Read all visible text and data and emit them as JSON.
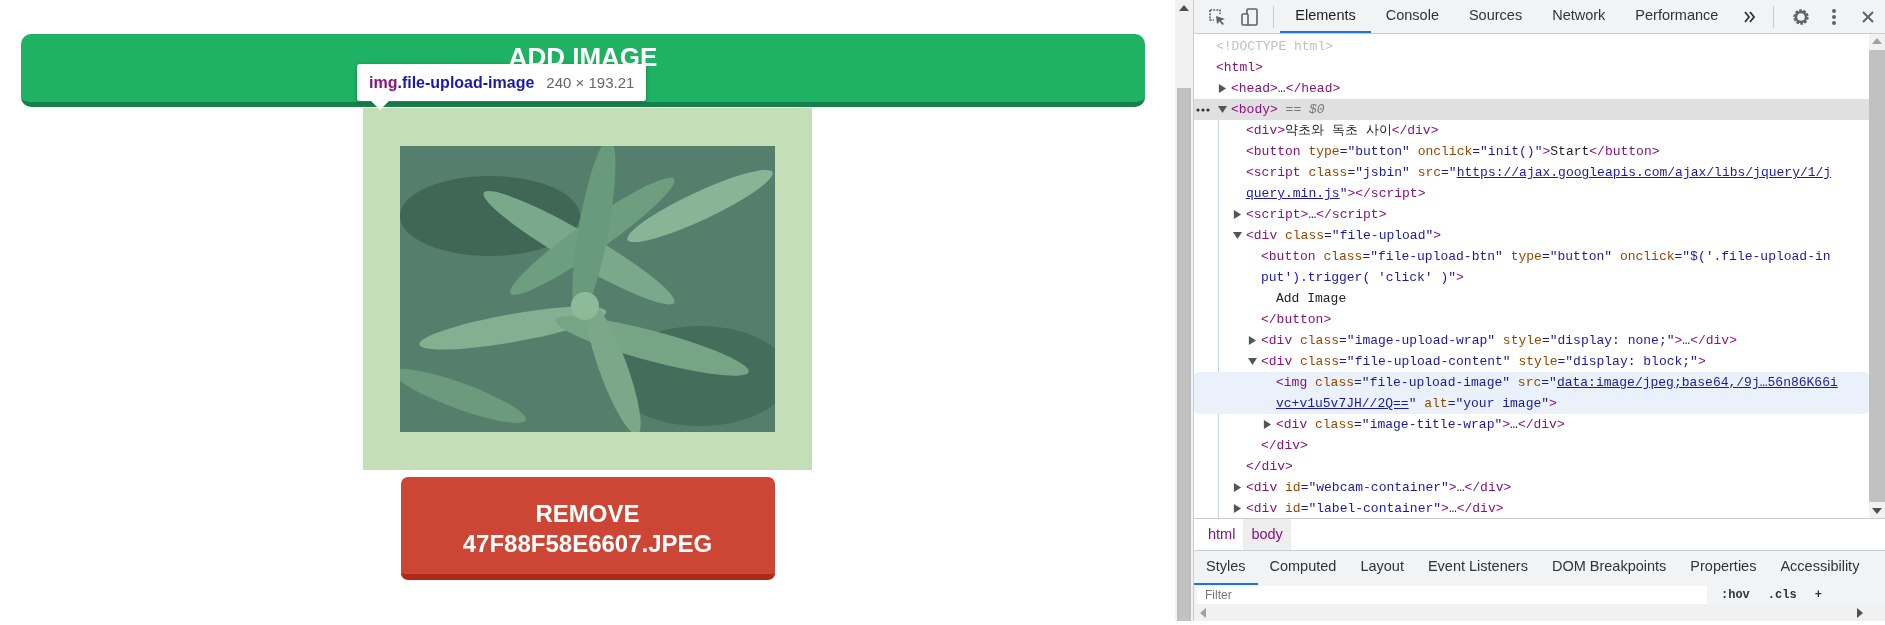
{
  "page": {
    "add_button": "ADD IMAGE",
    "tooltip": {
      "tag": "img",
      "class_name": ".file-upload-image",
      "size": "240 × 193.21"
    },
    "remove_button": "REMOVE 47F88F58E6607.JPEG"
  },
  "devtools": {
    "tabs": [
      {
        "label": "Elements",
        "selected": true
      },
      {
        "label": "Console",
        "selected": false
      },
      {
        "label": "Sources",
        "selected": false
      },
      {
        "label": "Network",
        "selected": false
      },
      {
        "label": "Performance",
        "selected": false
      }
    ],
    "dom": [
      {
        "kind": "plain",
        "selected": false,
        "hovered": false,
        "lines": [
          [
            {
              "kind": "doctype",
              "text": "<!DOCTYPE html>"
            }
          ]
        ]
      },
      {
        "kind": "plain",
        "selected": false,
        "hovered": false,
        "lines": [
          [
            {
              "kind": "tag",
              "text": "<html>"
            }
          ]
        ],
        "children": [
          {
            "kind": "branch",
            "expanded": false,
            "selected": false,
            "hovered": false,
            "lines": [
              [
                {
                  "kind": "tag",
                  "text": "<head>"
                },
                {
                  "kind": "text",
                  "text": "…"
                },
                {
                  "kind": "tag",
                  "text": "</head>"
                }
              ]
            ]
          },
          {
            "kind": "branch",
            "expanded": true,
            "selected": true,
            "hovered": false,
            "lines": [
              [
                {
                  "kind": "tag",
                  "text": "<body>"
                },
                {
                  "kind": "note",
                  "text": " == $0"
                }
              ]
            ],
            "children": [
              {
                "kind": "plain",
                "selected": false,
                "hovered": false,
                "lines": [
                  [
                    {
                      "kind": "tag",
                      "text": "<div>"
                    },
                    {
                      "kind": "text",
                      "text": "약초와 독초 사이"
                    },
                    {
                      "kind": "tag",
                      "text": "</div>"
                    }
                  ]
                ]
              },
              {
                "kind": "plain",
                "selected": false,
                "hovered": false,
                "lines": [
                  [
                    {
                      "kind": "tag",
                      "text": "<button"
                    },
                    {
                      "kind": "attr",
                      "text": " type"
                    },
                    {
                      "kind": "val",
                      "text": "=\"button\""
                    },
                    {
                      "kind": "attr",
                      "text": " onclick"
                    },
                    {
                      "kind": "val",
                      "text": "=\"init()\""
                    },
                    {
                      "kind": "tag",
                      "text": ">"
                    },
                    {
                      "kind": "text",
                      "text": "Start"
                    },
                    {
                      "kind": "tag",
                      "text": "</button>"
                    }
                  ]
                ]
              },
              {
                "kind": "plain",
                "selected": false,
                "hovered": false,
                "lines": [
                  [
                    {
                      "kind": "tag",
                      "text": "<script"
                    },
                    {
                      "kind": "attr",
                      "text": " class"
                    },
                    {
                      "kind": "val",
                      "text": "=\"jsbin\""
                    },
                    {
                      "kind": "attr",
                      "text": " src"
                    },
                    {
                      "kind": "val",
                      "text": "=\""
                    },
                    {
                      "kind": "link",
                      "text": "https://ajax.googleapis.com/ajax/libs/jquery/1/j"
                    }
                  ],
                  [
                    {
                      "kind": "link",
                      "text": "query.min.js"
                    },
                    {
                      "kind": "val",
                      "text": "\""
                    },
                    {
                      "kind": "tag",
                      "text": "></script>"
                    }
                  ]
                ]
              },
              {
                "kind": "branch",
                "expanded": false,
                "selected": false,
                "hovered": false,
                "lines": [
                  [
                    {
                      "kind": "tag",
                      "text": "<script>"
                    },
                    {
                      "kind": "text",
                      "text": "…"
                    },
                    {
                      "kind": "tag",
                      "text": "</script>"
                    }
                  ]
                ]
              },
              {
                "kind": "branch",
                "expanded": true,
                "selected": false,
                "hovered": false,
                "lines": [
                  [
                    {
                      "kind": "tag",
                      "text": "<div"
                    },
                    {
                      "kind": "attr",
                      "text": " class"
                    },
                    {
                      "kind": "val",
                      "text": "=\"file-upload\""
                    },
                    {
                      "kind": "tag",
                      "text": ">"
                    }
                  ]
                ],
                "children": [
                  {
                    "kind": "plain",
                    "selected": false,
                    "hovered": false,
                    "lines": [
                      [
                        {
                          "kind": "tag",
                          "text": "<button"
                        },
                        {
                          "kind": "attr",
                          "text": " class"
                        },
                        {
                          "kind": "val",
                          "text": "=\"file-upload-btn\""
                        },
                        {
                          "kind": "attr",
                          "text": " type"
                        },
                        {
                          "kind": "val",
                          "text": "=\"button\""
                        },
                        {
                          "kind": "attr",
                          "text": " onclick"
                        },
                        {
                          "kind": "val",
                          "text": "=\"$('.file-upload-in"
                        }
                      ],
                      [
                        {
                          "kind": "val",
                          "text": "put').trigger( 'click' )\""
                        },
                        {
                          "kind": "tag",
                          "text": ">"
                        }
                      ]
                    ],
                    "children": [
                      {
                        "kind": "plain",
                        "selected": false,
                        "hovered": false,
                        "lines": [
                          [
                            {
                              "kind": "text",
                              "text": "Add Image"
                            }
                          ]
                        ]
                      }
                    ],
                    "close": "</button>"
                  },
                  {
                    "kind": "branch",
                    "expanded": false,
                    "selected": false,
                    "hovered": false,
                    "lines": [
                      [
                        {
                          "kind": "tag",
                          "text": "<div"
                        },
                        {
                          "kind": "attr",
                          "text": " class"
                        },
                        {
                          "kind": "val",
                          "text": "=\"image-upload-wrap\""
                        },
                        {
                          "kind": "attr",
                          "text": " style"
                        },
                        {
                          "kind": "val",
                          "text": "=\"display: none;\""
                        },
                        {
                          "kind": "tag",
                          "text": ">"
                        },
                        {
                          "kind": "text",
                          "text": "…"
                        },
                        {
                          "kind": "tag",
                          "text": "</div>"
                        }
                      ]
                    ]
                  },
                  {
                    "kind": "branch",
                    "expanded": true,
                    "selected": false,
                    "hovered": false,
                    "lines": [
                      [
                        {
                          "kind": "tag",
                          "text": "<div"
                        },
                        {
                          "kind": "attr",
                          "text": " class"
                        },
                        {
                          "kind": "val",
                          "text": "=\"file-upload-content\""
                        },
                        {
                          "kind": "attr",
                          "text": " style"
                        },
                        {
                          "kind": "val",
                          "text": "=\"display: block;\""
                        },
                        {
                          "kind": "tag",
                          "text": ">"
                        }
                      ]
                    ],
                    "children": [
                      {
                        "kind": "plain",
                        "selected": false,
                        "hovered": true,
                        "lines": [
                          [
                            {
                              "kind": "tag",
                              "text": "<img"
                            },
                            {
                              "kind": "attr",
                              "text": " class"
                            },
                            {
                              "kind": "val",
                              "text": "=\"file-upload-image\""
                            },
                            {
                              "kind": "attr",
                              "text": " src"
                            },
                            {
                              "kind": "val",
                              "text": "=\""
                            },
                            {
                              "kind": "link",
                              "text": "data:image/jpeg;base64,/9j…56n86K66i"
                            }
                          ],
                          [
                            {
                              "kind": "link",
                              "text": "vc+v1u5v7JH//2Q=="
                            },
                            {
                              "kind": "val",
                              "text": "\""
                            },
                            {
                              "kind": "attr",
                              "text": " alt"
                            },
                            {
                              "kind": "val",
                              "text": "=\"your image\""
                            },
                            {
                              "kind": "tag",
                              "text": ">"
                            }
                          ]
                        ]
                      },
                      {
                        "kind": "branch",
                        "expanded": false,
                        "selected": false,
                        "hovered": false,
                        "lines": [
                          [
                            {
                              "kind": "tag",
                              "text": "<div"
                            },
                            {
                              "kind": "attr",
                              "text": " class"
                            },
                            {
                              "kind": "val",
                              "text": "=\"image-title-wrap\""
                            },
                            {
                              "kind": "tag",
                              "text": ">"
                            },
                            {
                              "kind": "text",
                              "text": "…"
                            },
                            {
                              "kind": "tag",
                              "text": "</div>"
                            }
                          ]
                        ]
                      }
                    ],
                    "close": "</div>"
                  }
                ],
                "close": "</div>"
              },
              {
                "kind": "branch",
                "expanded": false,
                "selected": false,
                "hovered": false,
                "lines": [
                  [
                    {
                      "kind": "tag",
                      "text": "<div"
                    },
                    {
                      "kind": "attr",
                      "text": " id"
                    },
                    {
                      "kind": "val",
                      "text": "=\"webcam-container\""
                    },
                    {
                      "kind": "tag",
                      "text": ">"
                    },
                    {
                      "kind": "text",
                      "text": "…"
                    },
                    {
                      "kind": "tag",
                      "text": "</div>"
                    }
                  ]
                ]
              },
              {
                "kind": "branch",
                "expanded": false,
                "selected": false,
                "hovered": false,
                "lines": [
                  [
                    {
                      "kind": "tag",
                      "text": "<div"
                    },
                    {
                      "kind": "attr",
                      "text": " id"
                    },
                    {
                      "kind": "val",
                      "text": "=\"label-container\""
                    },
                    {
                      "kind": "tag",
                      "text": ">"
                    },
                    {
                      "kind": "text",
                      "text": "…"
                    },
                    {
                      "kind": "tag",
                      "text": "</div>"
                    }
                  ]
                ]
              }
            ]
          }
        ]
      }
    ],
    "breadcrumbs": [
      {
        "label": "html",
        "selected": false
      },
      {
        "label": "body",
        "selected": true
      }
    ],
    "panel_tabs": [
      {
        "label": "Styles",
        "selected": true
      },
      {
        "label": "Computed",
        "selected": false
      },
      {
        "label": "Layout",
        "selected": false
      },
      {
        "label": "Event Listeners",
        "selected": false
      },
      {
        "label": "DOM Breakpoints",
        "selected": false
      },
      {
        "label": "Properties",
        "selected": false
      },
      {
        "label": "Accessibility",
        "selected": false
      }
    ],
    "filter": {
      "placeholder": "Filter"
    },
    "style_tools": [
      ":hov",
      ".cls",
      "+"
    ]
  }
}
